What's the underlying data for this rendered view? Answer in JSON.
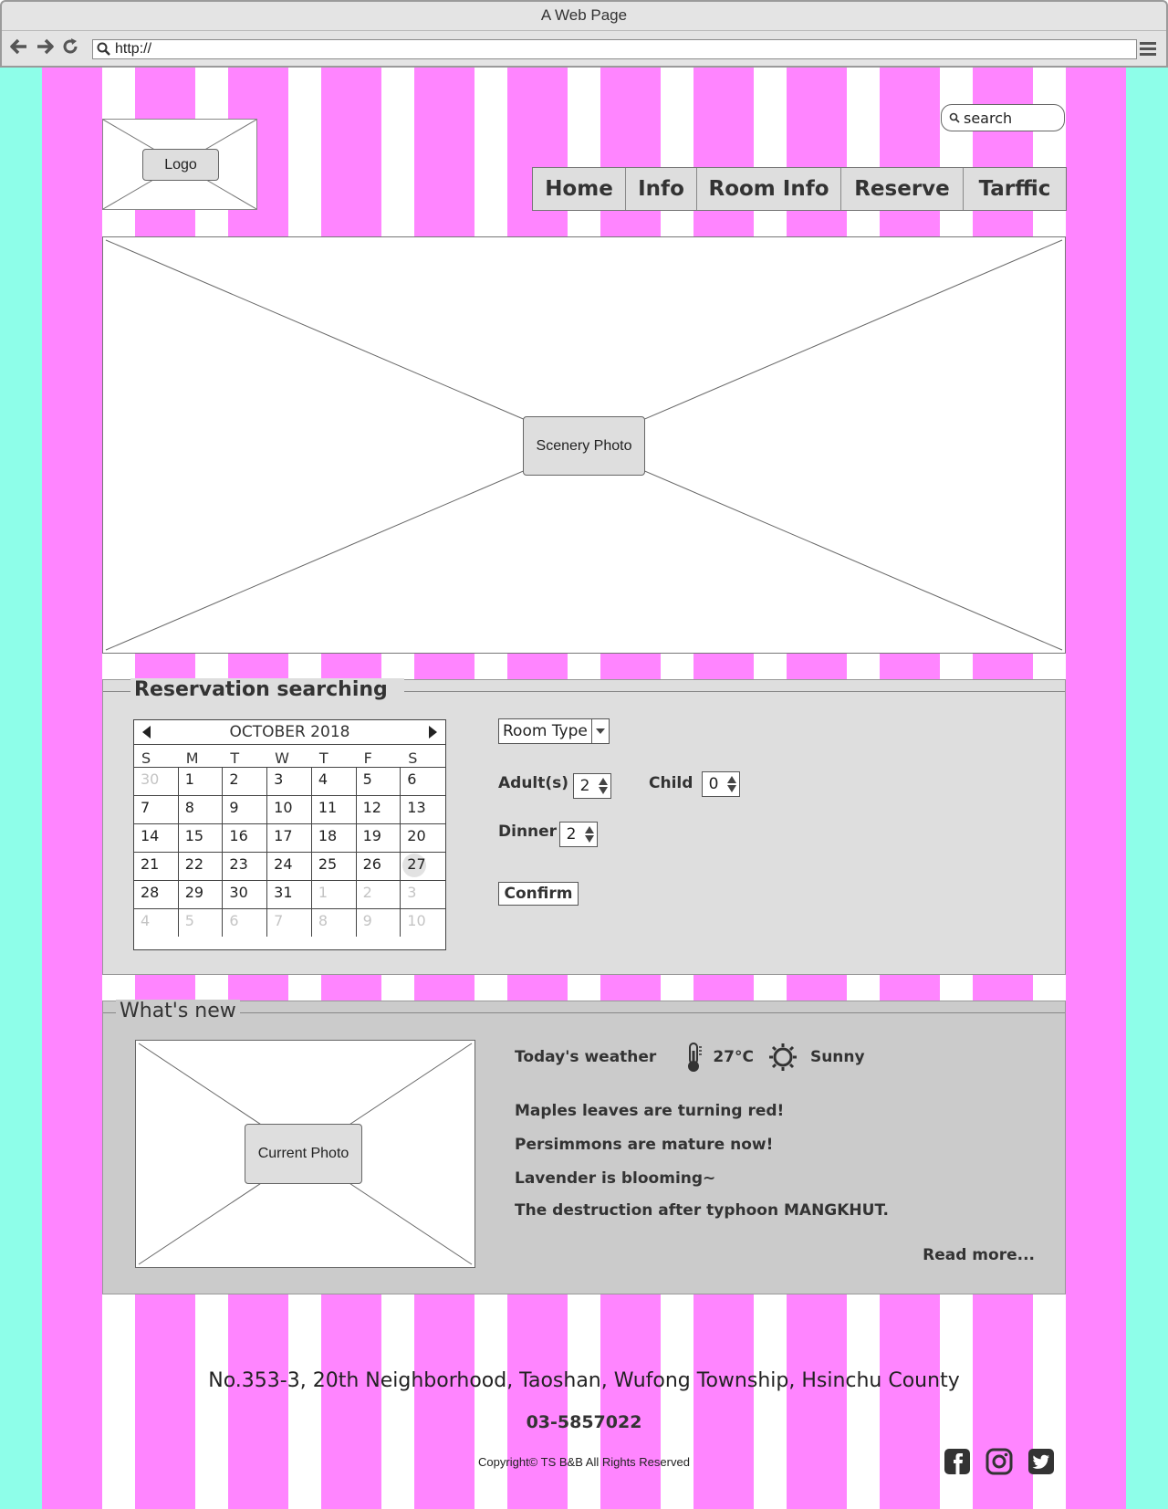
{
  "browser": {
    "title": "A Web Page",
    "url": "http://"
  },
  "header": {
    "logo_label": "Logo",
    "search_placeholder": "search",
    "nav": [
      "Home",
      "Info",
      "Room Info",
      "Reserve",
      "Tarffic"
    ]
  },
  "hero": {
    "label": "Scenery Photo"
  },
  "reservation": {
    "title": "Reservation searching",
    "calendar": {
      "month_label": "OCTOBER 2018",
      "weekdays": [
        "S",
        "M",
        "T",
        "W",
        "T",
        "F",
        "S"
      ],
      "days": [
        {
          "d": "30",
          "m": true
        },
        {
          "d": "1"
        },
        {
          "d": "2"
        },
        {
          "d": "3"
        },
        {
          "d": "4"
        },
        {
          "d": "5"
        },
        {
          "d": "6"
        },
        {
          "d": "7"
        },
        {
          "d": "8"
        },
        {
          "d": "9"
        },
        {
          "d": "10"
        },
        {
          "d": "11"
        },
        {
          "d": "12"
        },
        {
          "d": "13"
        },
        {
          "d": "14"
        },
        {
          "d": "15"
        },
        {
          "d": "16"
        },
        {
          "d": "17"
        },
        {
          "d": "18"
        },
        {
          "d": "19"
        },
        {
          "d": "20"
        },
        {
          "d": "21"
        },
        {
          "d": "22"
        },
        {
          "d": "23"
        },
        {
          "d": "24"
        },
        {
          "d": "25"
        },
        {
          "d": "26"
        },
        {
          "d": "27",
          "today": true
        },
        {
          "d": "28"
        },
        {
          "d": "29"
        },
        {
          "d": "30"
        },
        {
          "d": "31"
        },
        {
          "d": "1",
          "m": true
        },
        {
          "d": "2",
          "m": true
        },
        {
          "d": "3",
          "m": true
        },
        {
          "d": "4",
          "m": true
        },
        {
          "d": "5",
          "m": true
        },
        {
          "d": "6",
          "m": true
        },
        {
          "d": "7",
          "m": true
        },
        {
          "d": "8",
          "m": true
        },
        {
          "d": "9",
          "m": true
        },
        {
          "d": "10",
          "m": true
        }
      ]
    },
    "room_type": "Room Type",
    "adults_label": "Adult(s)",
    "adults_value": "2",
    "child_label": "Child",
    "child_value": "0",
    "dinner_label": "Dinner",
    "dinner_value": "2",
    "confirm_label": "Confirm"
  },
  "news": {
    "title": "What's new",
    "photo_label": "Current Photo",
    "weather_label": "Today's weather",
    "temperature": "27°C",
    "condition": "Sunny",
    "items": [
      "Maples leaves are turning red!",
      "Persimmons are mature now!",
      "Lavender is blooming~",
      "The destruction after typhoon MANGKHUT."
    ],
    "read_more": "Read more..."
  },
  "footer": {
    "address": "No.353-3, 20th Neighborhood, Taoshan, Wufong Township, Hsinchu County",
    "phone": "03-5857022",
    "copyright": "Copyright© TS B&B  All Rights Reserved",
    "social_icons": [
      "facebook-icon",
      "instagram-icon",
      "twitter-icon"
    ]
  },
  "colors": {
    "stripe_pink": "#ff85ff",
    "stripe_white": "#ffffff",
    "outer_mint": "#8efee9",
    "panel_gray": "#dedede",
    "news_gray": "#cbcbcb"
  }
}
